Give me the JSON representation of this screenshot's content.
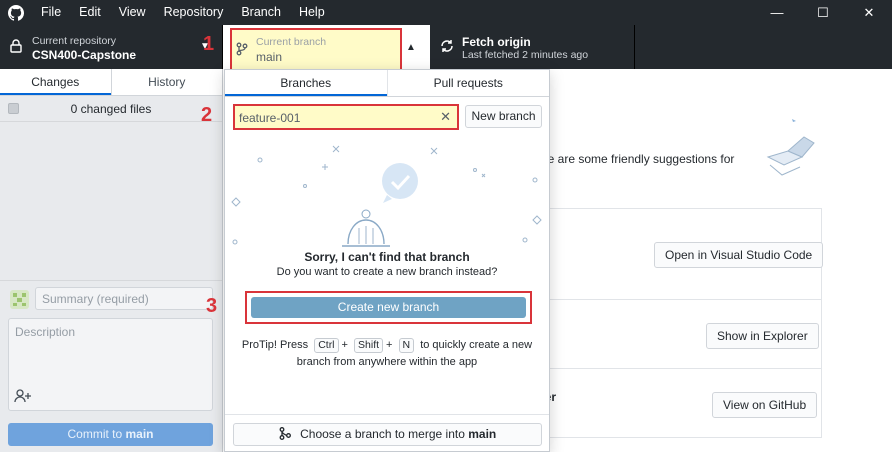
{
  "menubar": {
    "items": [
      "File",
      "Edit",
      "View",
      "Repository",
      "Branch",
      "Help"
    ]
  },
  "toolbar": {
    "repo_label": "Current repository",
    "repo_value": "CSN400-Capstone",
    "branch_label": "Current branch",
    "branch_value": "main",
    "fetch_label": "Fetch origin",
    "fetch_sub": "Last fetched 2 minutes ago"
  },
  "annotations": [
    "1",
    "2",
    "3"
  ],
  "left": {
    "tabs": [
      "Changes",
      "History"
    ],
    "changed_files": "0 changed files",
    "summary_placeholder": "Summary (required)",
    "description_placeholder": "Description",
    "commit_prefix": "Commit to ",
    "commit_branch": "main"
  },
  "popup": {
    "tabs": [
      "Branches",
      "Pull requests"
    ],
    "filter_value": "feature-001",
    "new_branch": "New branch",
    "sorry": "Sorry, I can't find that branch",
    "sorry_sub": "Do you want to create a new branch instead?",
    "create_button": "Create new branch",
    "protip_1": "ProTip! Press",
    "key_ctrl": "Ctrl",
    "key_shift": "Shift",
    "key_n": "N",
    "plus": "+",
    "protip_2": "to quickly create a new",
    "protip_3": "branch from anywhere within the app",
    "merge_prefix": "Choose a branch to merge into ",
    "merge_branch": "main"
  },
  "right": {
    "suggestion_fragment": "ere are some friendly suggestions for",
    "card1_button": "Open in Visual Studio Code",
    "card2_button": "Show in Explorer",
    "card3_title_fragment": "ser",
    "card3_button": "View on GitHub"
  },
  "colors": {
    "titlebar": "#24292e",
    "highlight": "#fffbc8",
    "annotation_red": "#d9343a",
    "create_button": "#6fa3c4",
    "commit_button": "#6fa3dd"
  },
  "icons": [
    "github-logo-icon",
    "lock-icon",
    "branch-icon",
    "caret-down-icon",
    "caret-up-icon",
    "sync-icon",
    "minimize-icon",
    "maximize-icon",
    "close-icon",
    "clear-icon",
    "bell-illustration-icon",
    "checkmark-icon",
    "avatar-icon",
    "add-coauthor-icon",
    "merge-icon"
  ]
}
